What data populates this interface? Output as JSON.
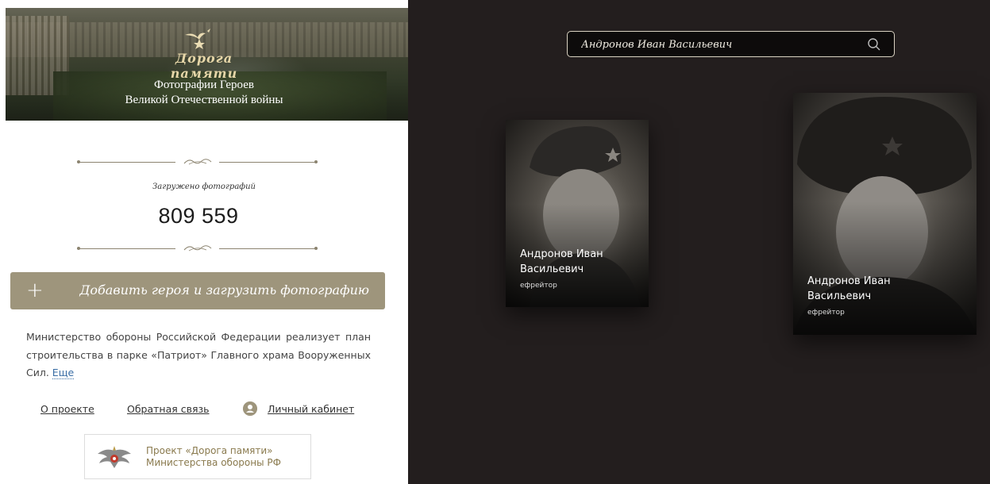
{
  "hero": {
    "logo_text": "Дорога памяти",
    "subtitle_line1": "Фотографии Героев",
    "subtitle_line2": "Великой Отечественной войны"
  },
  "stats": {
    "uploaded_label": "Загружено фотографий",
    "uploaded_count": "809 559"
  },
  "add_hero_button": {
    "plus": "+",
    "label": "Добавить героя и загрузить фотографию"
  },
  "about": {
    "text": "Министерство обороны Российской Федерации реализует план строительства в парке «Патриот» Главного храма Вооруженных Сил. ",
    "more_link": "Еще"
  },
  "nav": {
    "about": "О проекте",
    "feedback": "Обратная связь",
    "cabinet": "Личный кабинет"
  },
  "mo_badge": {
    "line1": "Проект «Дорога памяти»",
    "line2": "Министерства обороны РФ"
  },
  "search": {
    "value": "Андронов Иван Васильевич",
    "icon": "search-icon"
  },
  "results": [
    {
      "name_line1": "Андронов Иван",
      "name_line2": "Васильевич",
      "rank": "ефрейтор"
    },
    {
      "name_line1": "Андронов Иван",
      "name_line2": "Васильевич",
      "rank": "ефрейтор"
    }
  ],
  "colors": {
    "accent": "#9e957c",
    "right_bg": "#231e1e"
  }
}
